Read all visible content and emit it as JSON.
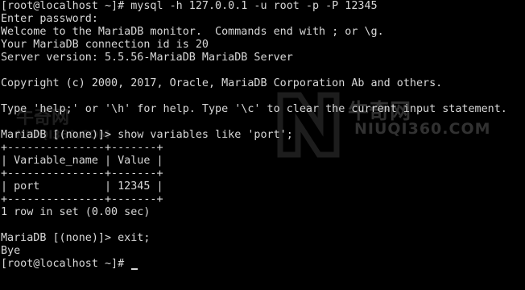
{
  "terminal": {
    "lines": [
      "[root@localhost ~]# mysql -h 127.0.0.1 -u root -p -P 12345",
      "Enter password:",
      "Welcome to the MariaDB monitor.  Commands end with ; or \\g.",
      "Your MariaDB connection id is 20",
      "Server version: 5.5.56-MariaDB MariaDB Server",
      "",
      "Copyright (c) 2000, 2017, Oracle, MariaDB Corporation Ab and others.",
      "",
      "Type 'help;' or '\\h' for help. Type '\\c' to clear the current input statement.",
      "",
      "MariaDB [(none)]> show variables like 'port';",
      "+---------------+-------+",
      "| Variable_name | Value |",
      "+---------------+-------+",
      "| port          | 12345 |",
      "+---------------+-------+",
      "1 row in set (0.00 sec)",
      "",
      "MariaDB [(none)]> exit;",
      "Bye",
      "[root@localhost ~]# "
    ]
  },
  "watermark": {
    "brand_cn": "牛奇网",
    "url": "NIUQI360.COM"
  },
  "colors": {
    "background": "#000000",
    "text": "#d8d8d8",
    "watermark": "#5a5a5a"
  }
}
